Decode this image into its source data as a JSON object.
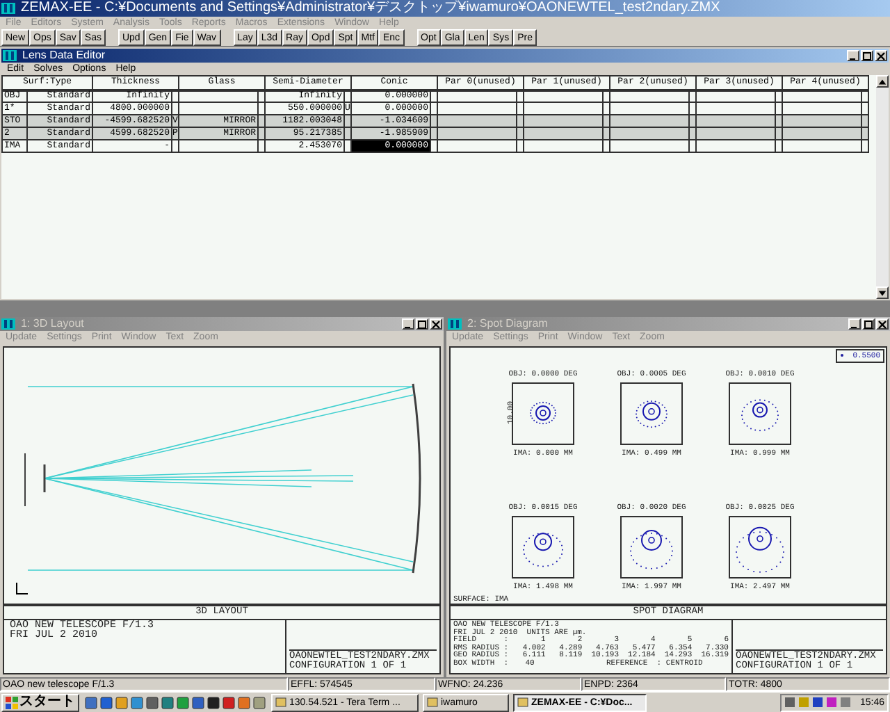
{
  "app": {
    "title": "ZEMAX-EE - C:¥Documents and Settings¥Administrator¥デスクトップ¥iwamuro¥OAONEWTEL_test2ndary.ZMX",
    "menu": [
      "File",
      "Editors",
      "System",
      "Analysis",
      "Tools",
      "Reports",
      "Macros",
      "Extensions",
      "Window",
      "Help"
    ],
    "toolbar": [
      [
        "New",
        "Ops",
        "Sav",
        "Sas"
      ],
      [
        "Upd",
        "Gen",
        "Fie",
        "Wav"
      ],
      [
        "Lay",
        "L3d",
        "Ray",
        "Opd",
        "Spt",
        "Mtf",
        "Enc"
      ],
      [
        "Opt",
        "Gla",
        "Len",
        "Sys",
        "Pre"
      ]
    ]
  },
  "lens_editor": {
    "title": "Lens Data Editor",
    "active": true,
    "menu": [
      "Edit",
      "Solves",
      "Options",
      "Help"
    ],
    "columns": [
      "Surf:Type",
      "Thickness",
      "Glass",
      "Semi-Diameter",
      "Conic",
      "Par 0(unused)",
      "Par 1(unused)",
      "Par 2(unused)",
      "Par 3(unused)",
      "Par 4(unused)"
    ],
    "rows": [
      {
        "shaded": false,
        "cells": [
          {
            "surface": "OBJ",
            "value": "Standard",
            "selected": false
          },
          {
            "value": "Infinity",
            "selected": false
          },
          {
            "selected": false
          },
          {
            "value": "Infinity",
            "selected": false
          },
          {
            "value": "0.000000",
            "selected": false
          }
        ]
      },
      {
        "shaded": false,
        "cells": [
          {
            "surface": "1*",
            "value": "Standard",
            "selected": false
          },
          {
            "value": "4800.000000",
            "selected": false
          },
          {
            "selected": false
          },
          {
            "value": "550.000000",
            "solve": "U",
            "selected": false
          },
          {
            "value": "0.000000",
            "selected": false
          }
        ]
      },
      {
        "shaded": true,
        "cells": [
          {
            "surface": "STO",
            "value": "Standard",
            "selected": false
          },
          {
            "value": "-4599.682520",
            "solve": "V",
            "selected": false
          },
          {
            "value": "MIRROR",
            "selected": false
          },
          {
            "value": "1182.003048",
            "selected": false
          },
          {
            "value": "-1.034609",
            "selected": false
          }
        ]
      },
      {
        "shaded": true,
        "cells": [
          {
            "surface": "2",
            "value": "Standard",
            "selected": false
          },
          {
            "value": "4599.682520",
            "solve": "P",
            "selected": false
          },
          {
            "value": "MIRROR",
            "selected": false
          },
          {
            "value": "95.217385",
            "selected": false
          },
          {
            "value": "-1.985909",
            "selected": false
          }
        ]
      },
      {
        "shaded": false,
        "cells": [
          {
            "surface": "IMA",
            "value": "Standard",
            "selected": false
          },
          {
            "value": "-",
            "selected": false
          },
          {
            "selected": false
          },
          {
            "value": "2.453070",
            "selected": false
          },
          {
            "value": "0.000000",
            "selected": true
          }
        ]
      }
    ]
  },
  "layout_window": {
    "title": "1: 3D Layout",
    "active": false,
    "menu": [
      "Update",
      "Settings",
      "Print",
      "Window",
      "Text",
      "Zoom"
    ],
    "caption": "3D LAYOUT",
    "info": [
      "OAO NEW TELESCOPE F/1.3",
      "FRI JUL 2 2010"
    ],
    "file": [
      "OAONEWTEL_TEST2NDARY.ZMX",
      "CONFIGURATION 1 OF 1"
    ]
  },
  "spot_window": {
    "title": "2: Spot Diagram",
    "active": false,
    "menu": [
      "Update",
      "Settings",
      "Print",
      "Window",
      "Text",
      "Zoom"
    ],
    "legend": "0.5500",
    "scale": "10.00",
    "surface": "SURFACE: IMA",
    "spots": [
      {
        "obj": "OBJ: 0.0000 DEG",
        "ima": "IMA: 0.000 MM"
      },
      {
        "obj": "OBJ: 0.0005 DEG",
        "ima": "IMA: 0.499 MM"
      },
      {
        "obj": "OBJ: 0.0010 DEG",
        "ima": "IMA: 0.999 MM"
      },
      {
        "obj": "OBJ: 0.0015 DEG",
        "ima": "IMA: 1.498 MM"
      },
      {
        "obj": "OBJ: 0.0020 DEG",
        "ima": "IMA: 1.997 MM"
      },
      {
        "obj": "OBJ: 0.0025 DEG",
        "ima": "IMA: 2.497 MM"
      }
    ],
    "caption": "SPOT DIAGRAM",
    "info": [
      "OAO NEW TELESCOPE F/1.3",
      "FRI JUL 2 2010  UNITS ARE µm."
    ],
    "table": [
      {
        "label": "FIELD      :",
        "values": [
          "1",
          "2",
          "3",
          "4",
          "5",
          "6"
        ]
      },
      {
        "label": "RMS RADIUS :",
        "values": [
          "4.002",
          "4.289",
          "4.763",
          "5.477",
          "6.354",
          "7.330"
        ]
      },
      {
        "label": "GEO RADIUS :",
        "values": [
          "6.111",
          "8.119",
          "10.193",
          "12.184",
          "14.293",
          "16.319"
        ]
      }
    ],
    "box_width": "BOX WIDTH  :",
    "box_value": "40",
    "reference": "REFERENCE  : CENTROID",
    "file": [
      "OAONEWTEL_TEST2NDARY.ZMX",
      "CONFIGURATION 1 OF 1"
    ]
  },
  "status_bar": [
    "OAO new telescope F/1.3",
    "EFFL: 574545",
    "WFNO: 24.236",
    "ENPD: 2364",
    "TOTR: 4800"
  ],
  "taskbar": {
    "start": "スタート",
    "tasks": [
      {
        "label": "130.54.521 - Tera Term ...",
        "selected": false
      },
      {
        "label": "iwamuro",
        "selected": false
      },
      {
        "label": "ZEMAX-EE - C:¥Doc...",
        "selected": true
      }
    ],
    "clock": "15:46"
  }
}
